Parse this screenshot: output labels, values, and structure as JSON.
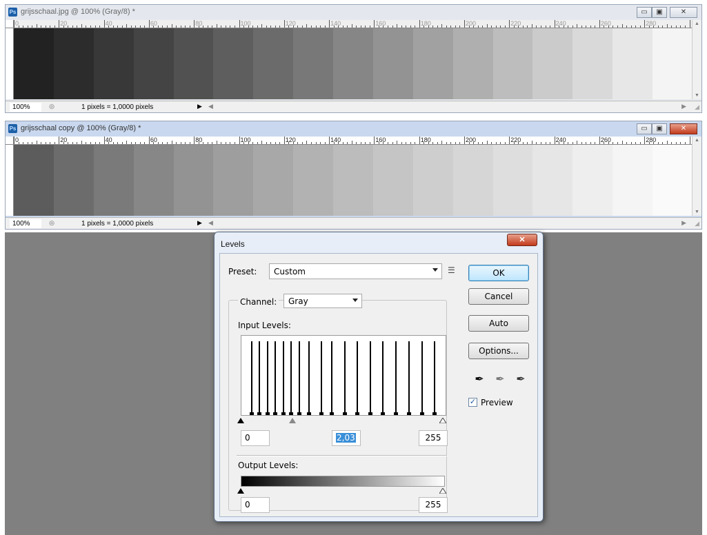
{
  "doc1": {
    "title": "grijsschaal.jpg @ 100% (Gray/8) *",
    "zoom": "100%",
    "status": "1 pixels = 1,0000 pixels",
    "ruler_labels": [
      "0",
      "20",
      "40",
      "60",
      "80",
      "100",
      "120",
      "140",
      "160",
      "180",
      "200",
      "220",
      "240",
      "260",
      "280"
    ],
    "strip_colors": [
      "#222222",
      "#2c2c2c",
      "#383838",
      "#444444",
      "#515151",
      "#5e5e5e",
      "#6b6b6b",
      "#787878",
      "#868686",
      "#939393",
      "#a1a1a1",
      "#afafaf",
      "#bdbdbd",
      "#cbcbcb",
      "#d9d9d9",
      "#e7e7e7",
      "#f4f4f4"
    ]
  },
  "doc2": {
    "title": "grijsschaal copy @ 100% (Gray/8) *",
    "zoom": "100%",
    "status": "1 pixels = 1,0000 pixels",
    "ruler_labels": [
      "0",
      "20",
      "40",
      "60",
      "80",
      "100",
      "120",
      "140",
      "160",
      "180",
      "200",
      "220",
      "240",
      "260",
      "280"
    ],
    "strip_colors": [
      "#5c5c5c",
      "#6c6c6c",
      "#7a7a7a",
      "#878787",
      "#939393",
      "#9e9e9e",
      "#a8a8a8",
      "#b2b2b2",
      "#bcbcbc",
      "#c5c5c5",
      "#cecece",
      "#d6d6d6",
      "#dedede",
      "#e6e6e6",
      "#eeeeee",
      "#f5f5f5",
      "#fafafa"
    ]
  },
  "window_buttons": {
    "minimize": "▭",
    "restore": "▣",
    "close": "✕"
  },
  "levels": {
    "title": "Levels",
    "close": "✕",
    "preset_label": "Preset:",
    "preset_value": "Custom",
    "channel_label": "Channel:",
    "channel_value": "Gray",
    "input_label": "Input Levels:",
    "input_black": "0",
    "input_gamma": "2,03",
    "input_white": "255",
    "input_gamma_fraction": 0.25,
    "output_label": "Output Levels:",
    "output_black": "0",
    "output_white": "255",
    "buttons": {
      "ok": "OK",
      "cancel": "Cancel",
      "auto": "Auto",
      "options": "Options..."
    },
    "preview_label": "Preview",
    "preview_checked": true,
    "histogram_peaks": [
      {
        "level": 12,
        "height": 0.93
      },
      {
        "level": 22,
        "height": 0.93
      },
      {
        "level": 32,
        "height": 0.93
      },
      {
        "level": 42,
        "height": 0.93
      },
      {
        "level": 52,
        "height": 0.93
      },
      {
        "level": 62,
        "height": 0.93
      },
      {
        "level": 72,
        "height": 0.93
      },
      {
        "level": 84,
        "height": 0.93
      },
      {
        "level": 100,
        "height": 0.93
      },
      {
        "level": 113,
        "height": 0.93
      },
      {
        "level": 129,
        "height": 0.93
      },
      {
        "level": 145,
        "height": 0.93
      },
      {
        "level": 161,
        "height": 0.93
      },
      {
        "level": 177,
        "height": 0.93
      },
      {
        "level": 193,
        "height": 0.93
      },
      {
        "level": 210,
        "height": 0.93
      },
      {
        "level": 226,
        "height": 0.93
      },
      {
        "level": 242,
        "height": 0.93
      }
    ]
  }
}
